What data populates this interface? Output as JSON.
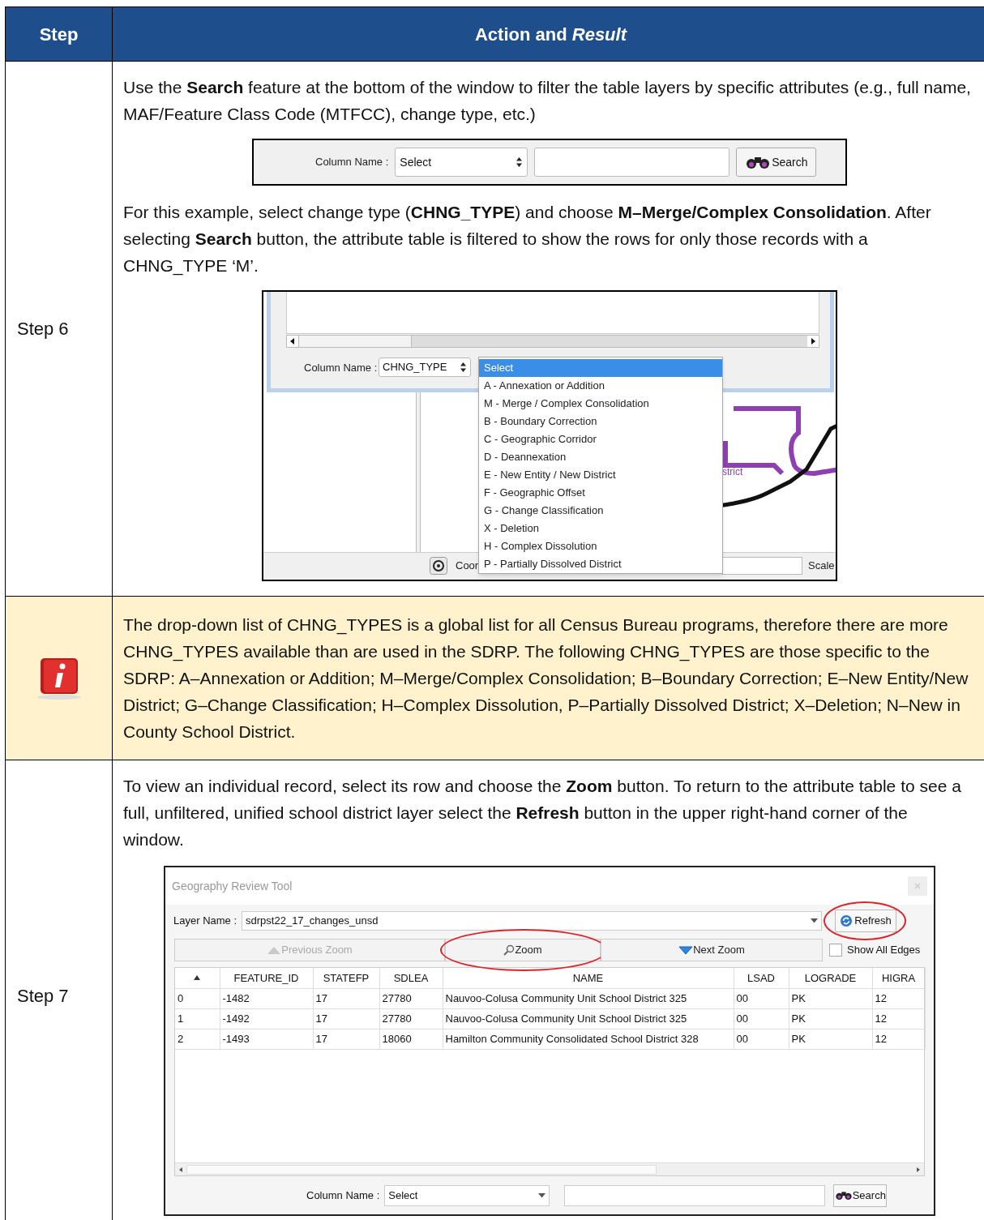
{
  "header": {
    "step": "Step",
    "action": "Action and *Result*"
  },
  "rows": [
    {
      "kind": "step",
      "step": "Step 6",
      "blocks": [
        {
          "kind": "text",
          "text": "Use the **Search** feature at the bottom of the window to filter the table layers by specific attributes (e.g., full name, MAF/Feature Class Code (MTFCC), change type, etc.)"
        },
        {
          "kind": "search_bar",
          "label": "Column Name :",
          "select": "Select",
          "button": "Search"
        },
        {
          "kind": "text",
          "text": "For this example, select change type (**CHNG_TYPE**) and choose **M–Merge/Complex Consolidation**. After selecting **Search** button, the attribute table is filtered to show the rows for only those records with a CHNG_TYPE ‘M’."
        },
        {
          "kind": "dropdown_shot",
          "label": "Column Name :",
          "select": "CHNG_TYPE",
          "map_label": "strict",
          "coords_label": "Coor",
          "scale_label": "Scale",
          "options": [
            {
              "text": "Select",
              "selected": true
            },
            {
              "text": "A - Annexation or Addition",
              "selected": false
            },
            {
              "text": "M - Merge / Complex Consolidation",
              "selected": false
            },
            {
              "text": "B - Boundary Correction",
              "selected": false
            },
            {
              "text": "C - Geographic Corridor",
              "selected": false
            },
            {
              "text": "D - Deannexation",
              "selected": false
            },
            {
              "text": "E - New Entity / New District",
              "selected": false
            },
            {
              "text": "F - Geographic Offset",
              "selected": false
            },
            {
              "text": "G - Change Classification",
              "selected": false
            },
            {
              "text": "X - Deletion",
              "selected": false
            },
            {
              "text": "H - Complex Dissolution",
              "selected": false
            },
            {
              "text": "P - Partially Dissolved District",
              "selected": false
            }
          ]
        }
      ]
    },
    {
      "kind": "note",
      "text": "The drop-down list of CHNG_TYPES is a global list for all Census Bureau programs, therefore there are more CHNG_TYPES available than are used in the SDRP. The following CHNG_TYPES are those specific to the SDRP: A–Annexation or Addition; M–Merge/Complex Consolidation; B–Boundary Correction; E–New Entity/New District; G–Change Classification; H–Complex Dissolution, P–Partially Dissolved District; X–Deletion; N–New in County School District."
    },
    {
      "kind": "step",
      "step": "Step 7",
      "blocks": [
        {
          "kind": "text",
          "text": "To view an individual record, select its row and choose the **Zoom** button. To return to the attribute table to see a full, unfiltered, unified school district layer select the **Refresh** button in the upper right-hand corner of the window."
        },
        {
          "kind": "review_tool",
          "title": "Geography Review Tool",
          "layer_label": "Layer Name :",
          "layer": "sdrpst22_17_changes_unsd",
          "refresh": {
            "label": "Refresh",
            "highlighted": true
          },
          "buttons": [
            {
              "label": "Previous Zoom",
              "kind": "up",
              "disabled": true,
              "highlighted": false
            },
            {
              "label": "Zoom",
              "kind": "zoom",
              "disabled": false,
              "highlighted": true
            },
            {
              "label": "Next Zoom",
              "kind": "down",
              "disabled": false,
              "highlighted": false
            }
          ],
          "show_all_edges": {
            "label": "Show All Edges",
            "checked": false
          },
          "columns": [
            "FEATURE_ID",
            "STATEFP",
            "SDLEA",
            "NAME",
            "LSAD",
            "LOGRADE",
            "HIGRA"
          ],
          "rows": [
            {
              "index": "0",
              "cells": [
                "-1482",
                "17",
                "27780",
                "Nauvoo-Colusa Community Unit School District 325",
                "00",
                "PK",
                "12"
              ]
            },
            {
              "index": "1",
              "cells": [
                "-1492",
                "17",
                "27780",
                "Nauvoo-Colusa Community Unit School District 325",
                "00",
                "PK",
                "12"
              ]
            },
            {
              "index": "2",
              "cells": [
                "-1493",
                "17",
                "18060",
                "Hamilton Community Consolidated School District 328",
                "00",
                "PK",
                "12"
              ]
            }
          ],
          "search": {
            "label": "Column Name :",
            "select": "Select",
            "button": "Search"
          }
        }
      ]
    }
  ]
}
